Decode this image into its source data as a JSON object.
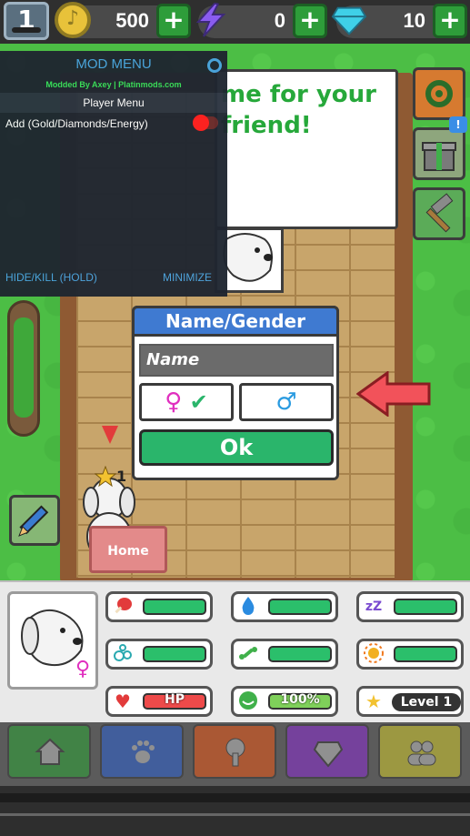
{
  "topbar": {
    "player_level": "1",
    "coins": "500",
    "energy": "0",
    "diamonds": "10",
    "plus": "+"
  },
  "mod_menu": {
    "title": "MOD MENU",
    "credit": "Modded By Axey | Platinmods.com",
    "section": "Player Menu",
    "option_label": "Add (Gold/Diamonds/Energy)",
    "hide_kill": "HIDE/KILL (HOLD)",
    "minimize": "MINIMIZE"
  },
  "bubble": {
    "text": "me for your friend!"
  },
  "dialog": {
    "title": "Name/Gender",
    "name_placeholder": "Name",
    "female_symbol": "♀",
    "male_symbol": "♂",
    "checkmark": "✔",
    "ok": "Ok"
  },
  "pet": {
    "star_count": "1",
    "home_sign": "Home",
    "gender_symbol": "♀"
  },
  "stats": {
    "hp_label": "HP",
    "happiness": "100%",
    "level": "Level 1"
  },
  "side": {
    "notice": "!"
  },
  "colors": {
    "accent_blue": "#3f7ad1",
    "ok_green": "#2ab56b",
    "grass": "#4cbe45",
    "mod_accent": "#4aa3e0"
  }
}
